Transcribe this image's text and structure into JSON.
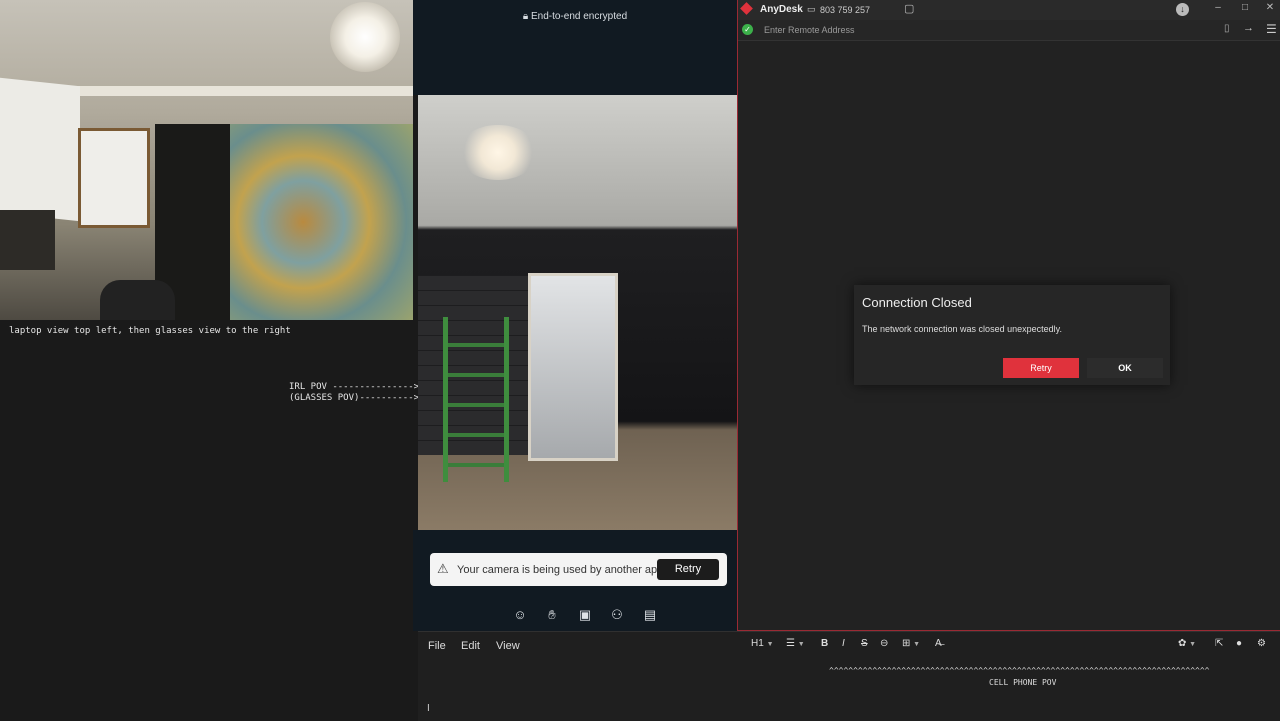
{
  "left_panel": {
    "caption": "laptop view top left, then glasses view to the right",
    "pov_line1": "IRL POV --------------->",
    "pov_line2": "(GLASSES POV)---------->"
  },
  "call": {
    "encryption_label": "End-to-end encrypted",
    "notice_text": "Your camera is being used by another app.",
    "notice_retry": "Retry",
    "toolbar_icons": [
      "emoji-icon",
      "raise-hand-icon",
      "share-screen-icon",
      "add-person-icon",
      "more-options-icon"
    ]
  },
  "anydesk": {
    "brand": "AnyDesk",
    "address_id": "803 759 257",
    "remote_address_placeholder": "Enter Remote Address",
    "brand_color": "#e0323c",
    "dialog": {
      "title": "Connection Closed",
      "message": "The network connection was closed unexpectedly.",
      "retry_label": "Retry",
      "ok_label": "OK"
    }
  },
  "editor": {
    "menus": [
      "File",
      "Edit",
      "View"
    ],
    "heading_label": "H1",
    "caret_line": "^^^^^^^^^^^^^^^^^^^^^^^^^^^^^^^^^^^^^^^^^^^^^^^^^^^^^^^^^^^^^^^^^^^^^^^^^^^^^^^",
    "cell_phone_label": "CELL PHONE POV"
  }
}
